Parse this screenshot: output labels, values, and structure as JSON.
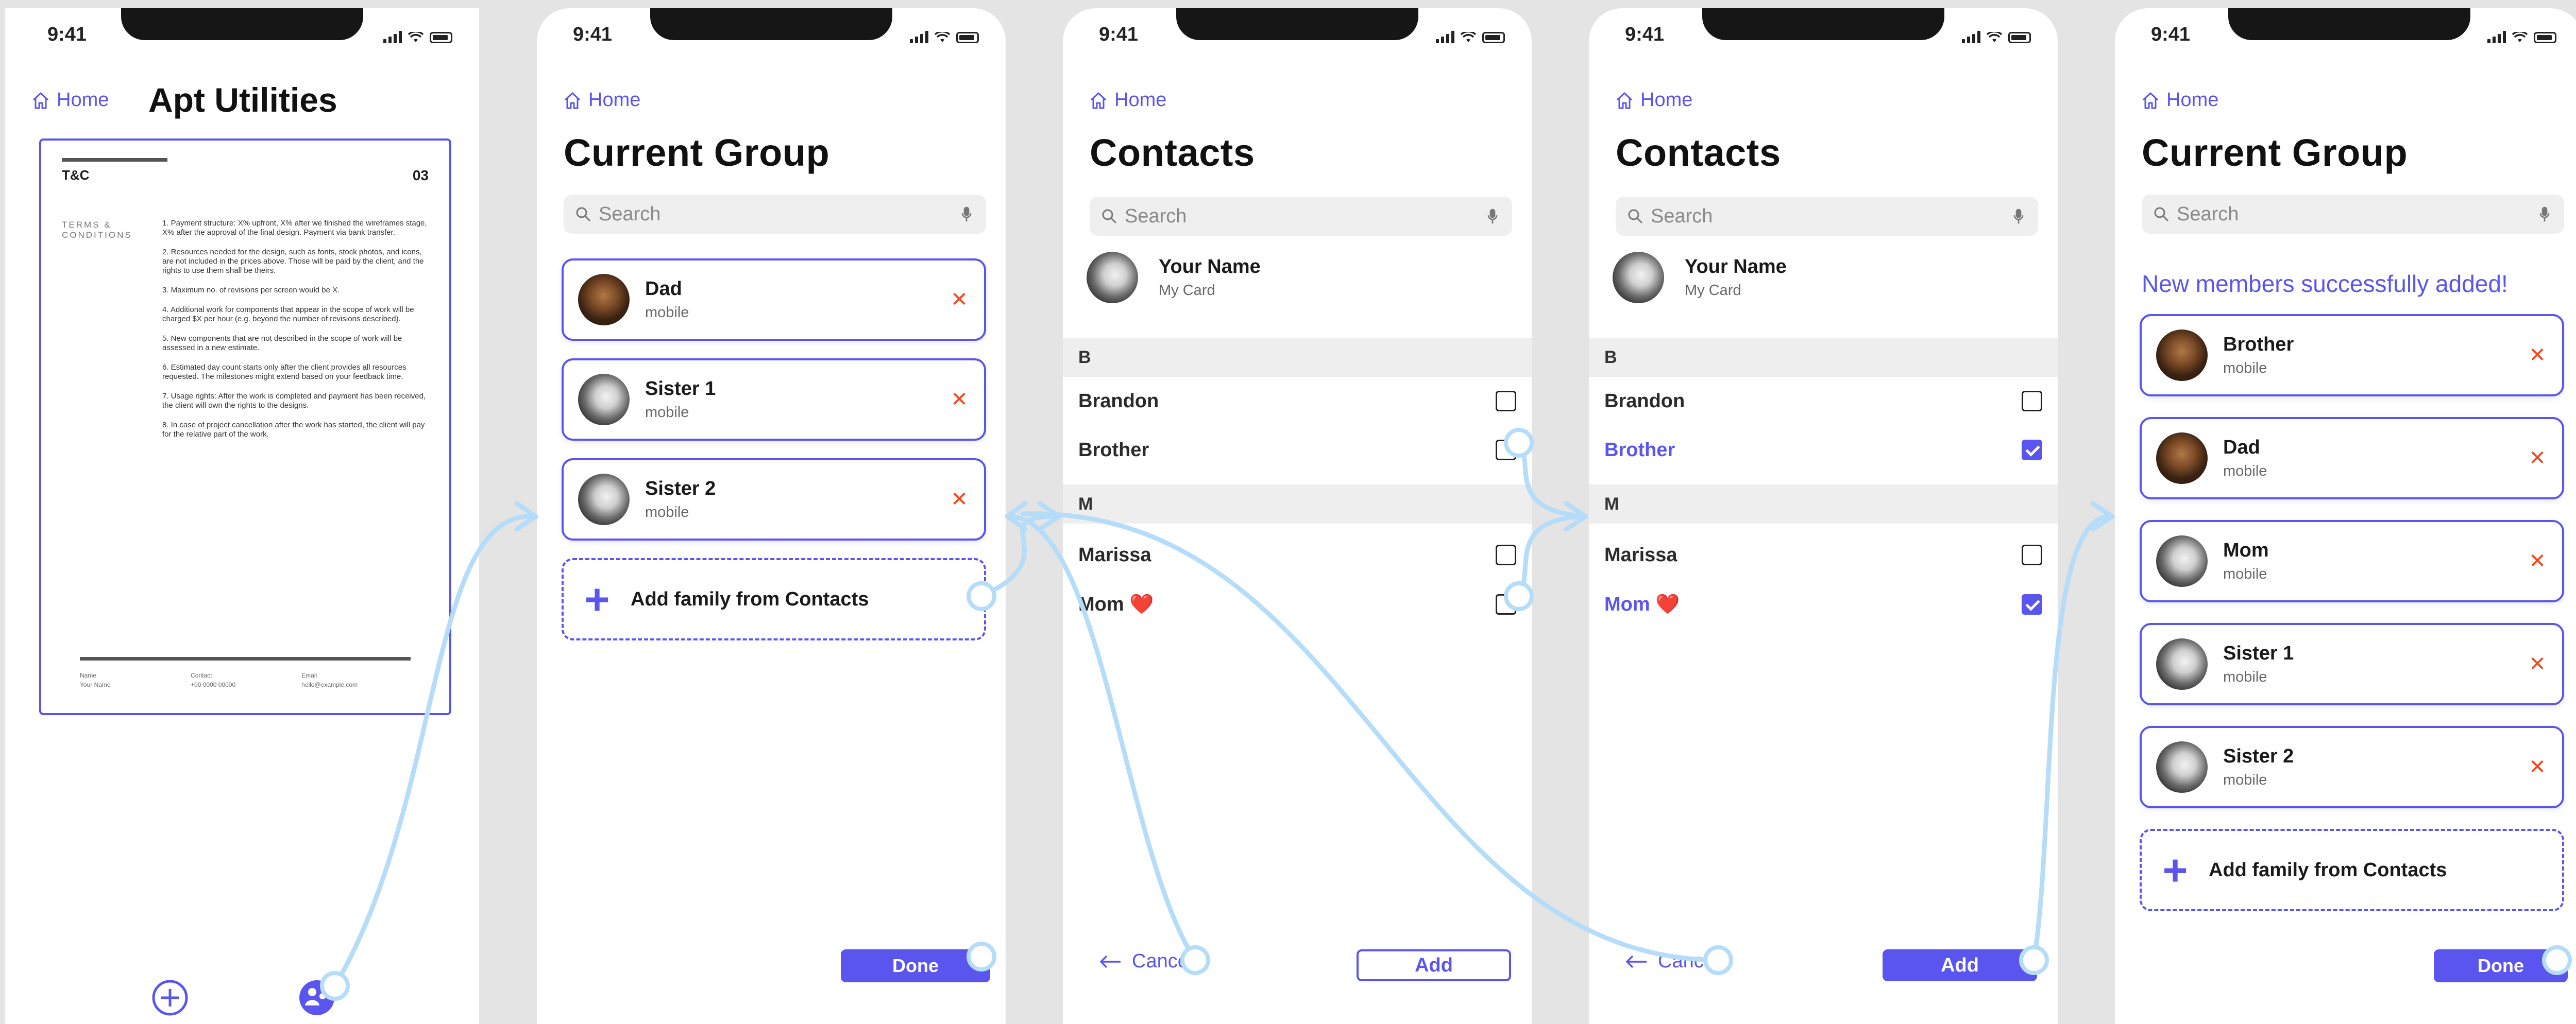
{
  "status": {
    "time": "9:41"
  },
  "screens": {
    "s1": {
      "home": "Home",
      "title": "Apt Utilities",
      "doc": {
        "label": "T&C",
        "page": "03",
        "side_label": "TERMS & CONDITIONS",
        "terms": [
          "1. Payment structure: X% upfront, X% after we finished the wireframes stage, X% after the approval of the final design. Payment via bank transfer.",
          "2. Resources needed for the design, such as fonts, stock photos, and icons, are not included in the prices above. Those will be paid by the client, and the rights to use them shall be theirs.",
          "3. Maximum no. of revisions per screen would be X.",
          "4. Additional work for components that appear in the scope of work will be charged $X per hour (e.g. beyond the number of revisions described).",
          "5. New components that are not described in the scope of work will be assessed in a new estimate.",
          "6. Estimated day count starts only after the client provides all resources requested. The milestones might extend based on your feedback time.",
          "7. Usage rights: After the work is completed and payment has been received, the client will own the rights to the designs.",
          "8. In case of project cancellation after the work has started, the client will pay for the relative part of the work."
        ],
        "footer": [
          {
            "label": "Name",
            "value": "Your Name"
          },
          {
            "label": "Contact",
            "value": "+00 0000 00000"
          },
          {
            "label": "Email",
            "value": "hello@example.com"
          }
        ]
      }
    },
    "s2": {
      "home": "Home",
      "title": "Current Group",
      "search_placeholder": "Search",
      "members": [
        {
          "name": "Dad",
          "type": "mobile",
          "avatar": "brown"
        },
        {
          "name": "Sister 1",
          "type": "mobile",
          "avatar": "gray"
        },
        {
          "name": "Sister 2",
          "type": "mobile",
          "avatar": "gray"
        }
      ],
      "add_label": "Add family from Contacts",
      "done": "Done"
    },
    "s3": {
      "home": "Home",
      "title": "Contacts",
      "search_placeholder": "Search",
      "me": {
        "name": "Your Name",
        "sub": "My Card"
      },
      "sections": [
        {
          "letter": "B",
          "rows": [
            {
              "name": "Brandon",
              "checked": false
            },
            {
              "name": "Brother",
              "checked": false
            }
          ]
        },
        {
          "letter": "M",
          "rows": [
            {
              "name": "Marissa",
              "checked": false
            },
            {
              "name": "Mom ❤️",
              "checked": false
            }
          ]
        }
      ],
      "cancel": "Cancel",
      "add": "Add"
    },
    "s4": {
      "home": "Home",
      "title": "Contacts",
      "search_placeholder": "Search",
      "me": {
        "name": "Your Name",
        "sub": "My Card"
      },
      "sections": [
        {
          "letter": "B",
          "rows": [
            {
              "name": "Brandon",
              "checked": false
            },
            {
              "name": "Brother",
              "checked": true
            }
          ]
        },
        {
          "letter": "M",
          "rows": [
            {
              "name": "Marissa",
              "checked": false
            },
            {
              "name": "Mom ❤️",
              "checked": true
            }
          ]
        }
      ],
      "cancel": "Cancel",
      "add": "Add"
    },
    "s5": {
      "home": "Home",
      "title": "Current Group",
      "search_placeholder": "Search",
      "success": "New members successfully added!",
      "members": [
        {
          "name": "Brother",
          "type": "mobile",
          "avatar": "brown"
        },
        {
          "name": "Dad",
          "type": "mobile",
          "avatar": "brown"
        },
        {
          "name": "Mom",
          "type": "mobile",
          "avatar": "gray"
        },
        {
          "name": "Sister 1",
          "type": "mobile",
          "avatar": "gray"
        },
        {
          "name": "Sister 2",
          "type": "mobile",
          "avatar": "gray"
        }
      ],
      "add_label": "Add family from Contacts",
      "done": "Done"
    }
  },
  "icons": {
    "home": "home-icon",
    "search": "search-icon",
    "mic": "microphone-icon",
    "remove": "close-icon",
    "add": "plus-icon",
    "back": "arrow-left-icon",
    "add_circle": "add-circle-icon",
    "family": "family-icon"
  },
  "colors": {
    "accent": "#5a55ee",
    "remove": "#f04a22",
    "flow_line": "#b5dcf9",
    "background": "#e4e4e4"
  }
}
